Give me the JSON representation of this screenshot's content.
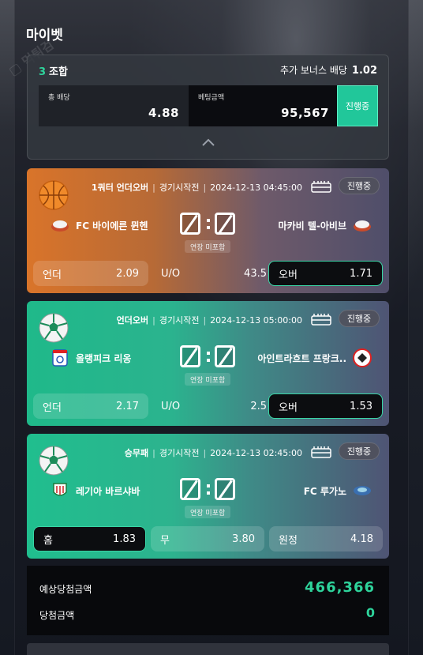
{
  "page": {
    "title": "마이벳"
  },
  "summary": {
    "combo_count": "3",
    "combo_label": "조합",
    "bonus_label": "추가 보너스 배당",
    "bonus_value": "1.02",
    "total_odds_label": "총 배당",
    "total_odds_value": "4.88",
    "bet_amount_label": "베팅금액",
    "bet_amount_value": "95,567",
    "status_label": "진행중"
  },
  "bets": [
    {
      "sport_icon": "basketball-icon",
      "market": "1쿼터 언더오버",
      "state": "경기시작전",
      "datetime": "2024-12-13 04:45:00",
      "status": "진행중",
      "home_team": "FC 바이에른 뮌헨",
      "away_team": "마카비 텔-아비브",
      "home_score": "0",
      "away_score": "0",
      "extra_time": "연장 미포함",
      "options": [
        {
          "label": "언더",
          "odds": "2.09"
        },
        {
          "label": "U/O",
          "odds": "43.5"
        },
        {
          "label": "오버",
          "odds": "1.71"
        }
      ]
    },
    {
      "sport_icon": "soccer-ball-icon",
      "market": "언더오버",
      "state": "경기시작전",
      "datetime": "2024-12-13 05:00:00",
      "status": "진행중",
      "home_team": "올랭피크 리옹",
      "away_team": "아인트라흐트 프랑크..",
      "home_score": "0",
      "away_score": "0",
      "extra_time": "연장 미포함",
      "options": [
        {
          "label": "언더",
          "odds": "2.17"
        },
        {
          "label": "U/O",
          "odds": "2.5"
        },
        {
          "label": "오버",
          "odds": "1.53"
        }
      ]
    },
    {
      "sport_icon": "soccer-ball-icon",
      "market": "승무패",
      "state": "경기시작전",
      "datetime": "2024-12-13 02:45:00",
      "status": "진행중",
      "home_team": "레기아 바르샤바",
      "away_team": "FC 루가노",
      "home_score": "0",
      "away_score": "0",
      "extra_time": "연장 미포함",
      "options": [
        {
          "label": "홈",
          "odds": "1.83"
        },
        {
          "label": "무",
          "odds": "3.80"
        },
        {
          "label": "원정",
          "odds": "4.18"
        }
      ]
    }
  ],
  "result": {
    "expected_win_label": "예상당첨금액",
    "expected_win_value": "466,366",
    "win_label": "당첨금액",
    "win_value": "0"
  },
  "colors": {
    "accent": "#2ed39b",
    "selected_border": "#39d6a6",
    "status_button": "#21c79a"
  }
}
